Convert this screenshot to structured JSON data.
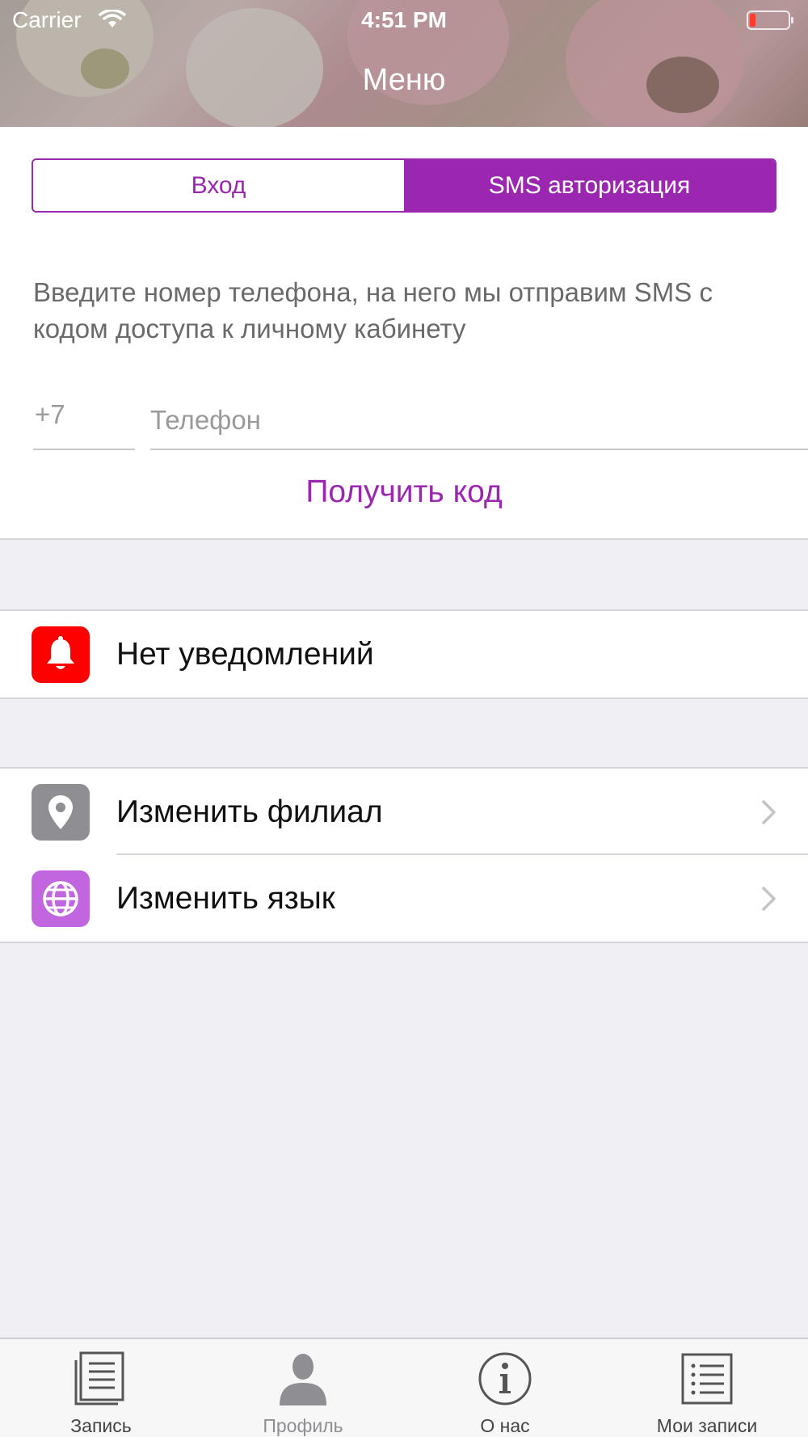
{
  "status_bar": {
    "carrier": "Carrier",
    "time": "4:51 PM"
  },
  "nav": {
    "title": "Меню"
  },
  "auth": {
    "tabs": [
      {
        "label": "Вход",
        "active": false
      },
      {
        "label": "SMS авторизация",
        "active": true
      }
    ],
    "hint": "Введите номер телефона, на него мы отправим SMS с кодом доступа к личному кабинету",
    "country_code": "+7",
    "phone_placeholder": "Телефон",
    "phone_value": "",
    "get_code_label": "Получить код"
  },
  "notifications": {
    "label": "Нет уведомлений",
    "icon": "bell-icon",
    "icon_color": "#ff0000"
  },
  "settings": {
    "items": [
      {
        "label": "Изменить филиал",
        "icon": "location-pin-icon",
        "icon_color": "#8e8e93"
      },
      {
        "label": "Изменить язык",
        "icon": "globe-icon",
        "icon_color": "#c266e0"
      }
    ]
  },
  "tabbar": {
    "tabs": [
      {
        "label": "Запись",
        "icon": "document-icon"
      },
      {
        "label": "Профиль",
        "icon": "person-icon"
      },
      {
        "label": "О нас",
        "icon": "info-icon"
      },
      {
        "label": "Мои записи",
        "icon": "list-icon"
      }
    ]
  },
  "colors": {
    "accent": "#9b27b0",
    "background": "#efeff4"
  }
}
